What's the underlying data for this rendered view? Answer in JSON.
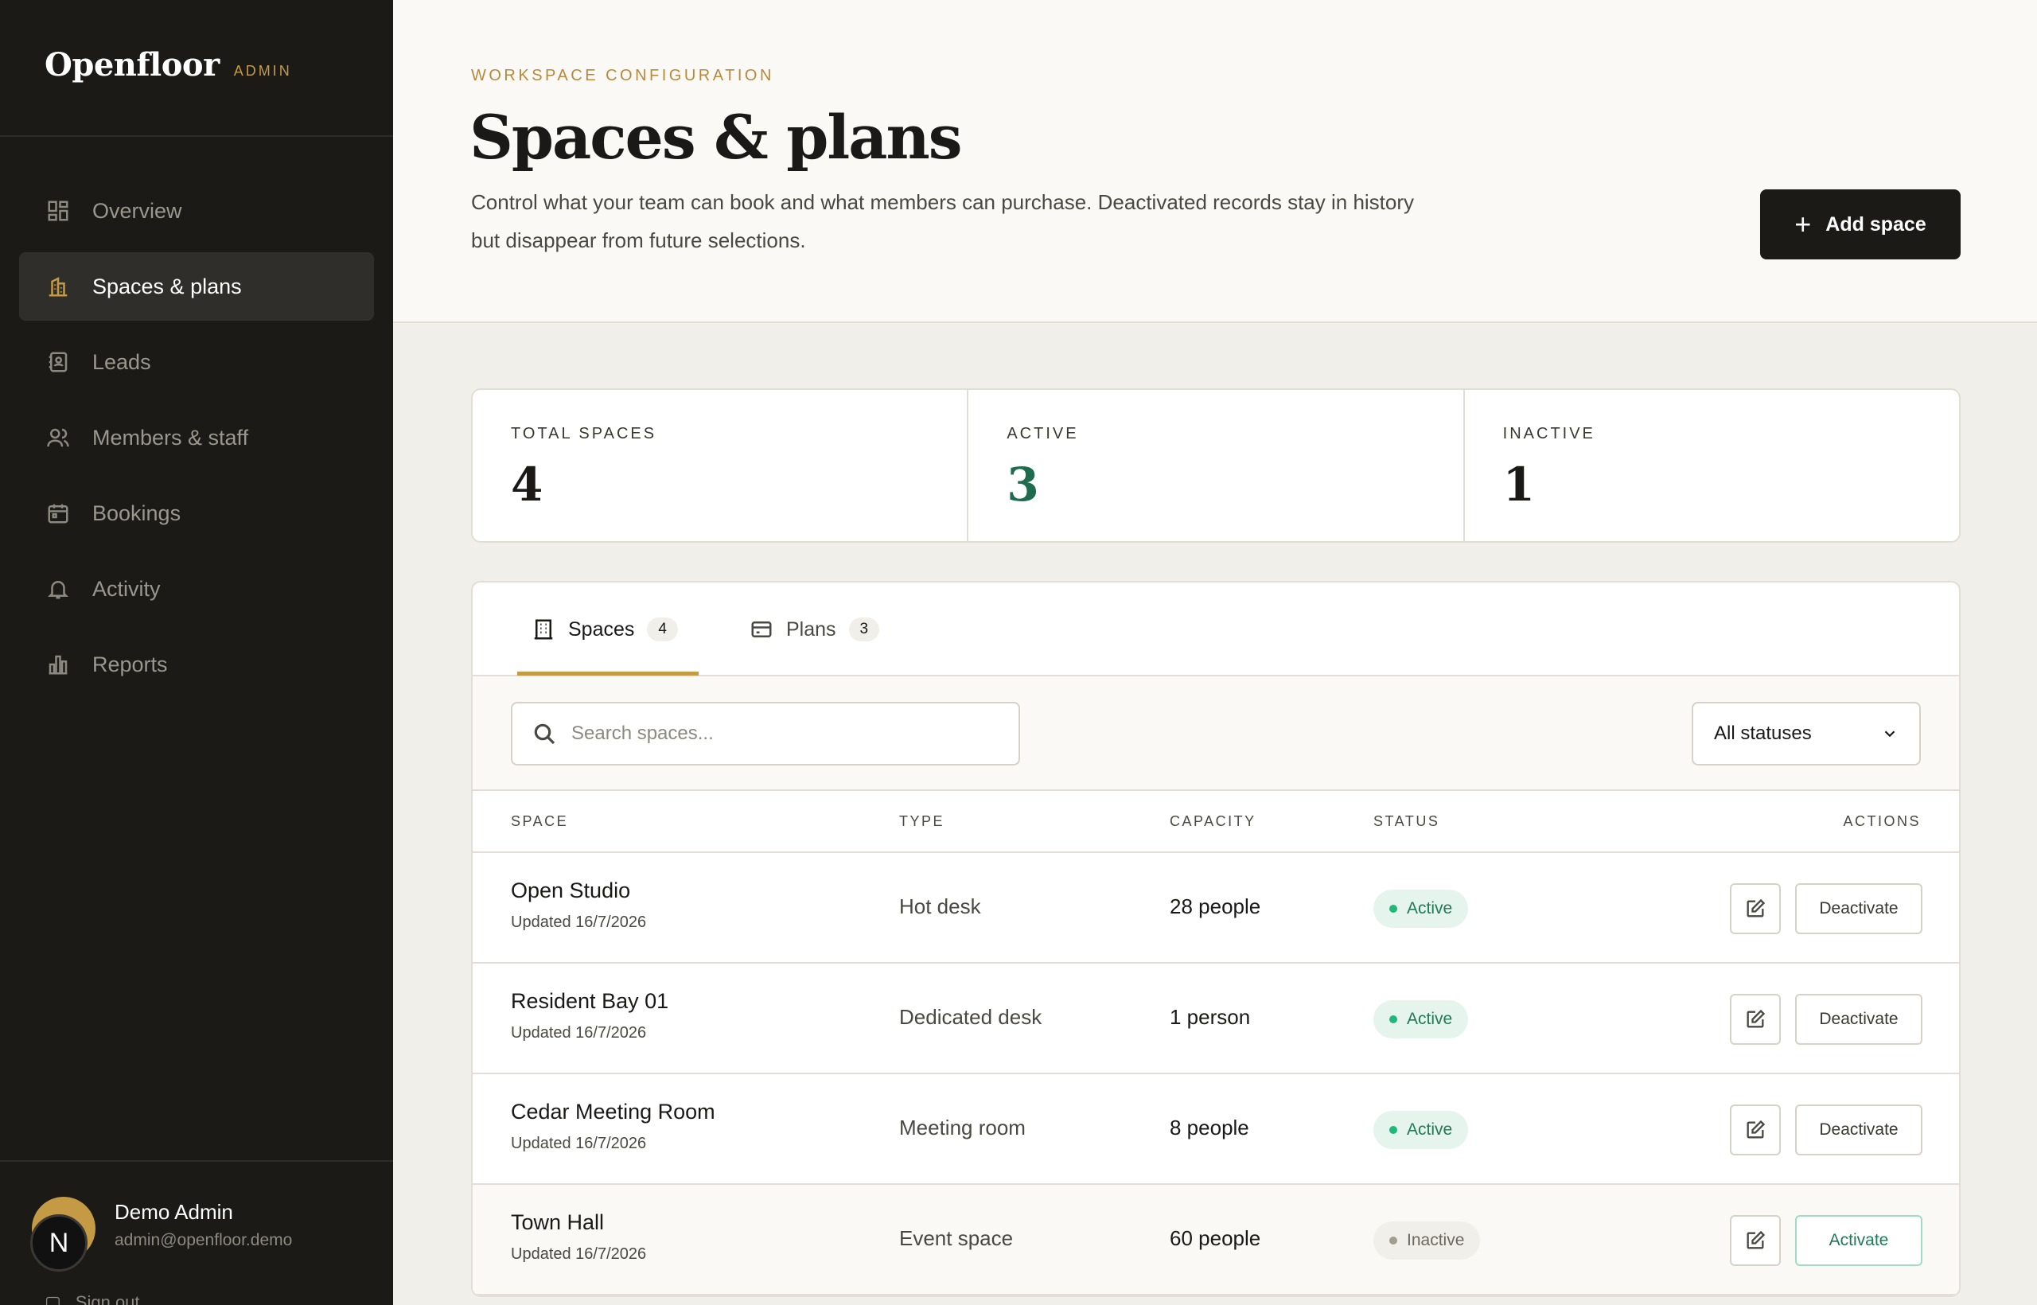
{
  "brand": {
    "name": "Openfloor",
    "tag": "ADMIN"
  },
  "nav": [
    {
      "label": "Overview",
      "icon": "grid-icon",
      "active": false
    },
    {
      "label": "Spaces & plans",
      "icon": "building-icon",
      "active": true
    },
    {
      "label": "Leads",
      "icon": "contact-card-icon",
      "active": false
    },
    {
      "label": "Members & staff",
      "icon": "users-icon",
      "active": false
    },
    {
      "label": "Bookings",
      "icon": "calendar-icon",
      "active": false
    },
    {
      "label": "Activity",
      "icon": "bell-icon",
      "active": false
    },
    {
      "label": "Reports",
      "icon": "bar-chart-icon",
      "active": false
    }
  ],
  "user": {
    "initial": "N",
    "name": "Demo Admin",
    "email": "admin@openfloor.demo",
    "signout": "Sign out"
  },
  "header": {
    "eyebrow": "WORKSPACE CONFIGURATION",
    "title": "Spaces & plans",
    "description": "Control what your team can book and what members can purchase. Deactivated records stay in history but disappear from future selections.",
    "add_button": "Add space"
  },
  "stats": [
    {
      "label": "TOTAL SPACES",
      "value": "4"
    },
    {
      "label": "ACTIVE",
      "value": "3"
    },
    {
      "label": "INACTIVE",
      "value": "1"
    }
  ],
  "tabs": [
    {
      "label": "Spaces",
      "count": "4",
      "active": true
    },
    {
      "label": "Plans",
      "count": "3",
      "active": false
    }
  ],
  "search": {
    "placeholder": "Search spaces...",
    "value": ""
  },
  "filter": {
    "selected": "All statuses"
  },
  "table": {
    "headers": {
      "space": "SPACE",
      "type": "TYPE",
      "capacity": "CAPACITY",
      "status": "STATUS",
      "actions": "ACTIONS"
    },
    "rows": [
      {
        "name": "Open Studio",
        "updated": "Updated 16/7/2026",
        "type": "Hot desk",
        "capacity": "28 people",
        "status": "Active",
        "action": "Deactivate"
      },
      {
        "name": "Resident Bay 01",
        "updated": "Updated 16/7/2026",
        "type": "Dedicated desk",
        "capacity": "1 person",
        "status": "Active",
        "action": "Deactivate"
      },
      {
        "name": "Cedar Meeting Room",
        "updated": "Updated 16/7/2026",
        "type": "Meeting room",
        "capacity": "8 people",
        "status": "Active",
        "action": "Deactivate"
      },
      {
        "name": "Town Hall",
        "updated": "Updated 16/7/2026",
        "type": "Event space",
        "capacity": "60 people",
        "status": "Inactive",
        "action": "Activate"
      }
    ]
  },
  "colors": {
    "accent": "#c49a45",
    "sidebar": "#1b1a17",
    "active_green": "#1f7a55"
  }
}
